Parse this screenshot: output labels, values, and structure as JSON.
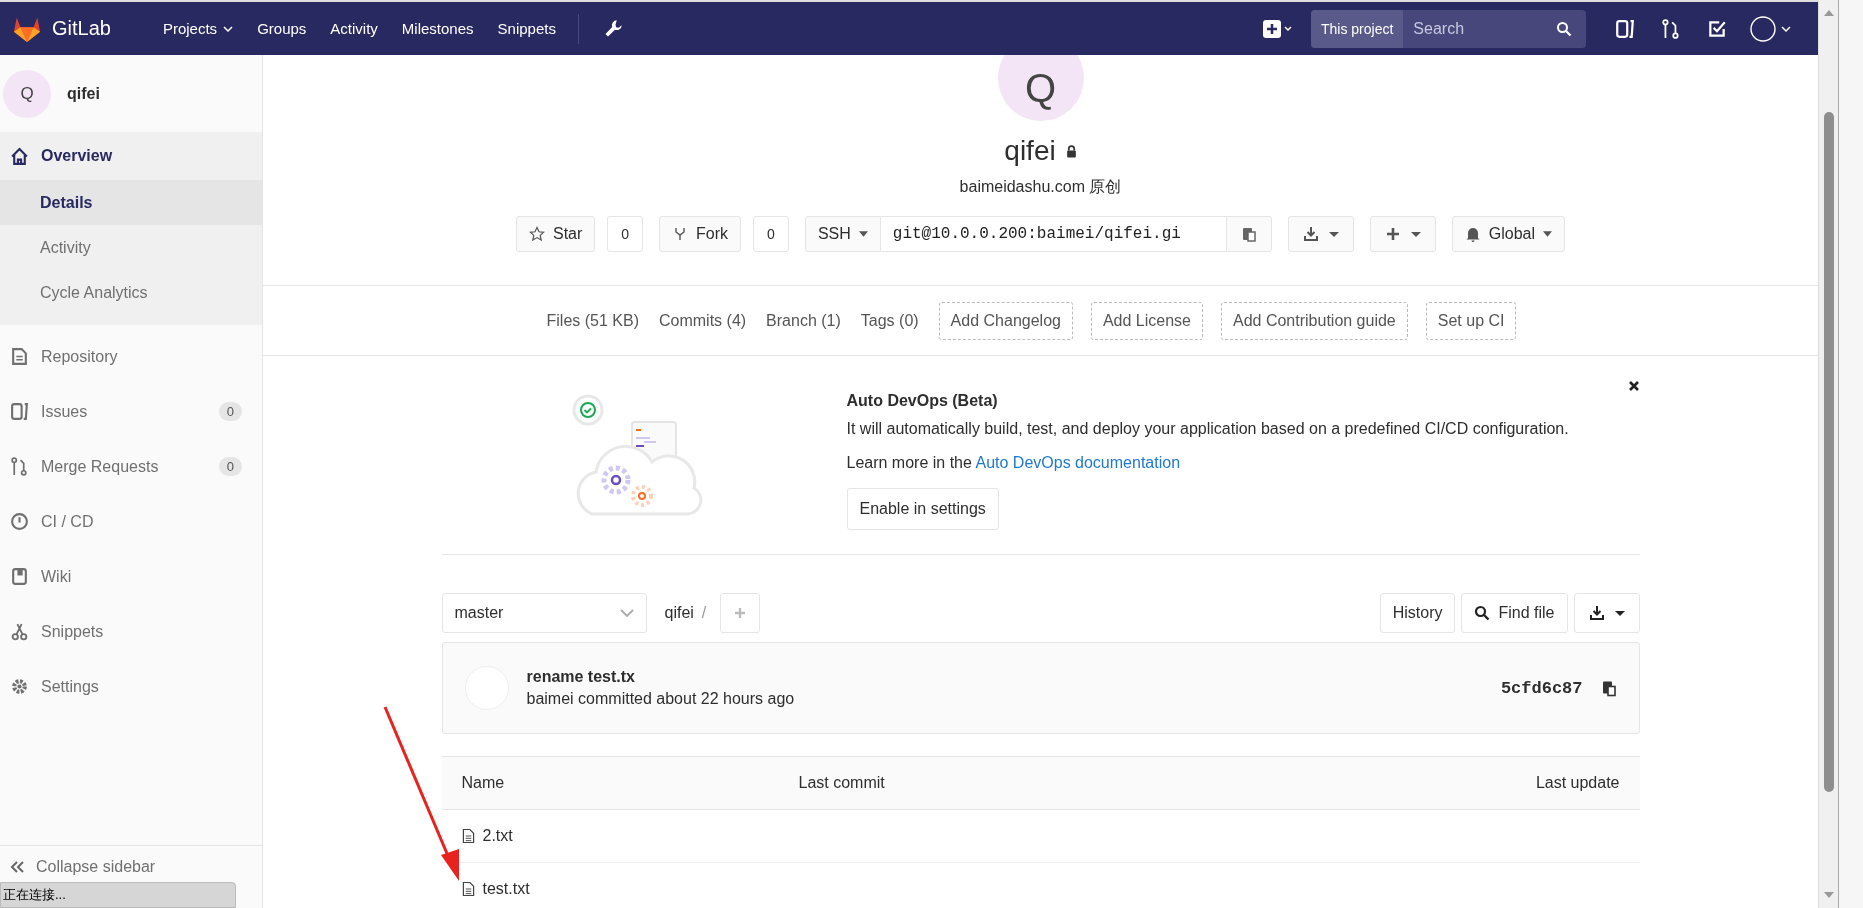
{
  "nav": {
    "logo": "GitLab",
    "links": [
      {
        "label": "Projects",
        "has_menu": true
      },
      {
        "label": "Groups",
        "has_menu": false
      },
      {
        "label": "Activity",
        "has_menu": false
      },
      {
        "label": "Milestones",
        "has_menu": false
      },
      {
        "label": "Snippets",
        "has_menu": false
      }
    ],
    "search": {
      "scope": "This project",
      "placeholder": "Search"
    }
  },
  "sidebar": {
    "project": {
      "initial": "Q",
      "name": "qifei"
    },
    "items": [
      {
        "label": "Overview",
        "selected": true,
        "expanded": true,
        "children": [
          {
            "label": "Details",
            "selected": true
          },
          {
            "label": "Activity",
            "selected": false
          },
          {
            "label": "Cycle Analytics",
            "selected": false
          }
        ]
      },
      {
        "label": "Repository",
        "selected": false
      },
      {
        "label": "Issues",
        "selected": false,
        "count": "0"
      },
      {
        "label": "Merge Requests",
        "selected": false,
        "count": "0"
      },
      {
        "label": "CI / CD",
        "selected": false
      },
      {
        "label": "Wiki",
        "selected": false
      },
      {
        "label": "Snippets",
        "selected": false
      },
      {
        "label": "Settings",
        "selected": false
      }
    ],
    "collapse": "Collapse sidebar"
  },
  "project": {
    "avatar": "Q",
    "name": "qifei",
    "private": true,
    "description": "baimeidashu.com 原创",
    "star": {
      "label": "Star",
      "count": "0"
    },
    "fork": {
      "label": "Fork",
      "count": "0"
    },
    "clone": {
      "protocol": "SSH",
      "url": "git@10.0.0.200:baimei/qifei.gi"
    },
    "notification": "Global"
  },
  "stats": [
    "Files (51 KB)",
    "Commits (4)",
    "Branch (1)",
    "Tags (0)"
  ],
  "actions": [
    "Add Changelog",
    "Add License",
    "Add Contribution guide",
    "Set up CI"
  ],
  "devops": {
    "title": "Auto DevOps (Beta)",
    "text": "It will automatically build, test, and deploy your application based on a predefined CI/CD configuration.",
    "learn_prefix": "Learn more in the",
    "link": "Auto DevOps documentation",
    "button": "Enable in settings"
  },
  "repo": {
    "branch": "master",
    "path": "qifei",
    "separator": "/",
    "history": "History",
    "find_file": "Find file"
  },
  "commit": {
    "title": "rename test.tx",
    "meta": "baimei committed about 22 hours ago",
    "sha": "5cfd6c87"
  },
  "table": {
    "columns": [
      "Name",
      "Last commit",
      "Last update"
    ],
    "rows": [
      {
        "name": "2.txt"
      },
      {
        "name": "test.txt"
      }
    ]
  },
  "status_bar": "正在连接..."
}
